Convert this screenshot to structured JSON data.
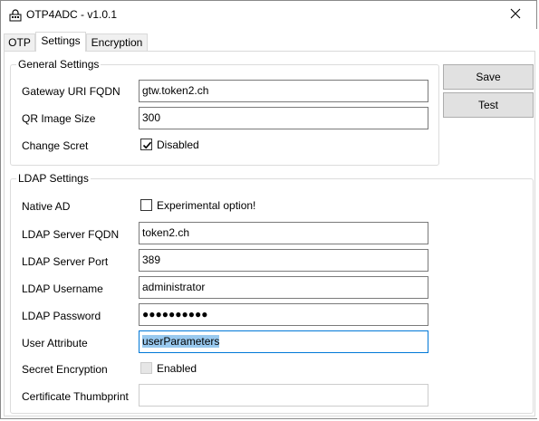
{
  "window": {
    "title": "OTP4ADC - v1.0.1"
  },
  "tabs": [
    {
      "label": "OTP"
    },
    {
      "label": "Settings"
    },
    {
      "label": "Encryption"
    }
  ],
  "general": {
    "title": "General Settings",
    "gateway_label": "Gateway URI FQDN",
    "gateway_value": "gtw.token2.ch",
    "qr_label": "QR Image Size",
    "qr_value": "300",
    "change_label": "Change Scret",
    "change_checkbox_label": "Disabled",
    "change_checked": true
  },
  "buttons": {
    "save": "Save",
    "test": "Test"
  },
  "ldap": {
    "title": "LDAP Settings",
    "native_label": "Native AD",
    "native_checkbox_label": "Experimental option!",
    "native_checked": false,
    "server_label": "LDAP Server FQDN",
    "server_value": "token2.ch",
    "port_label": "LDAP Server Port",
    "port_value": "389",
    "username_label": "LDAP Username",
    "username_value": "administrator",
    "password_label": "LDAP Password",
    "password_value": "●●●●●●●●●●",
    "attribute_label": "User Attribute",
    "attribute_value": "userParameters",
    "encryption_label": "Secret Encryption",
    "encryption_checkbox_label": "Enabled",
    "encryption_checked": false,
    "thumbprint_label": "Certificate Thumbprint",
    "thumbprint_value": ""
  }
}
